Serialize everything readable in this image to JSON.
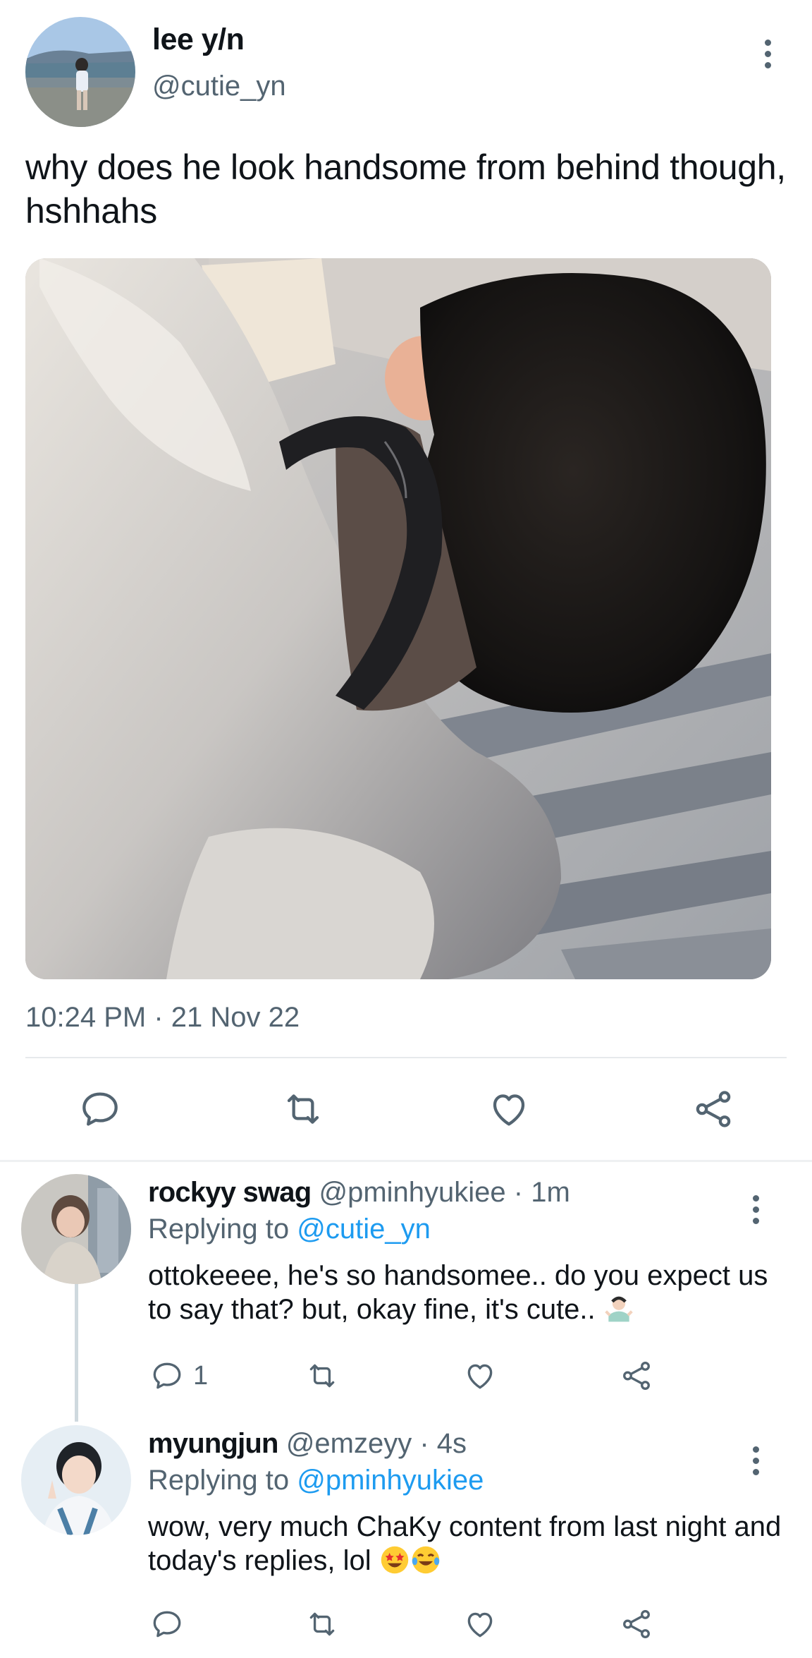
{
  "main_tweet": {
    "display_name": "lee y/n",
    "handle": "@cutie_yn",
    "text": "why does he look handsome from behind though, hshhahs",
    "timestamp": "10:24 PM · 21 Nov 22",
    "photo": "photo-person-with-headphones-lying-on-bed",
    "actions": [
      "reply-icon",
      "retweet-icon",
      "like-icon",
      "share-icon"
    ]
  },
  "replies": [
    {
      "display_name": "rockyy swag",
      "handle": "@pminhyukiee",
      "time": "· 1m",
      "replying_label": "Replying to",
      "replying_to": "@cutie_yn",
      "text": "ottokeeee, he's so handsomee.. do you expect us to say that? but, okay fine, it's cute..",
      "emoji": [
        "person-shrugging-emoji"
      ],
      "reply_count": "1"
    },
    {
      "display_name": "myungjun",
      "handle": "@emzeyy",
      "time": "· 4s",
      "replying_label": "Replying to",
      "replying_to": "@pminhyukiee",
      "text": "wow, very much ChaKy content from last night and today's replies, lol",
      "emoji": [
        "star-struck-emoji",
        "tears-of-joy-emoji"
      ],
      "reply_count": ""
    }
  ],
  "colors": {
    "text": "#0f1419",
    "secondary": "#536471",
    "link": "#1d9bf0",
    "divider": "#e6e9ec"
  }
}
